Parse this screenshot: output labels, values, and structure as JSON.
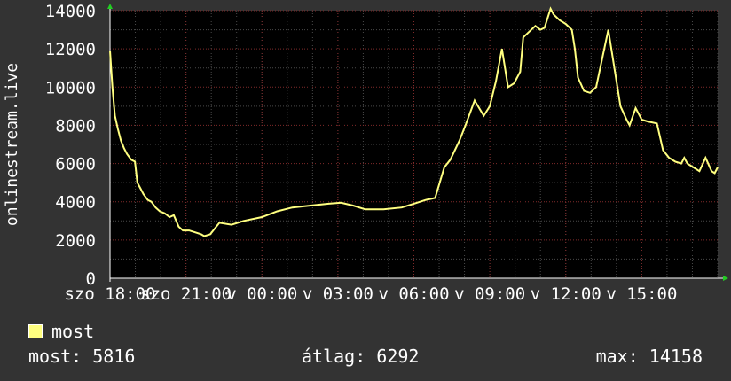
{
  "chart_data": {
    "type": "line",
    "ylabel": "onlinestream.live",
    "ylim": [
      0,
      14000
    ],
    "y_ticks": [
      0,
      2000,
      4000,
      6000,
      8000,
      10000,
      12000,
      14000
    ],
    "x_ticks": [
      {
        "label": "szo 18:00",
        "pos": 0.0
      },
      {
        "label": "szo 21:00",
        "pos": 0.125
      },
      {
        "label": "v 00:00",
        "pos": 0.25
      },
      {
        "label": "v 03:00",
        "pos": 0.375
      },
      {
        "label": "v 06:00",
        "pos": 0.5
      },
      {
        "label": "v 09:00",
        "pos": 0.625
      },
      {
        "label": "v 12:00",
        "pos": 0.75
      },
      {
        "label": "v 15:00",
        "pos": 0.875
      }
    ],
    "x_range": [
      0,
      1
    ],
    "grid": true,
    "series": [
      {
        "name": "most",
        "color": "#ffff80",
        "x": [
          0.0,
          0.004,
          0.008,
          0.013,
          0.018,
          0.023,
          0.028,
          0.035,
          0.041,
          0.045,
          0.05,
          0.055,
          0.062,
          0.068,
          0.075,
          0.082,
          0.09,
          0.098,
          0.105,
          0.113,
          0.12,
          0.13,
          0.14,
          0.15,
          0.155,
          0.165,
          0.18,
          0.2,
          0.22,
          0.25,
          0.275,
          0.3,
          0.33,
          0.36,
          0.38,
          0.4,
          0.42,
          0.45,
          0.48,
          0.5,
          0.52,
          0.535,
          0.55,
          0.56,
          0.575,
          0.585,
          0.6,
          0.615,
          0.625,
          0.635,
          0.645,
          0.655,
          0.665,
          0.675,
          0.68,
          0.69,
          0.7,
          0.708,
          0.715,
          0.725,
          0.73,
          0.74,
          0.75,
          0.76,
          0.765,
          0.77,
          0.78,
          0.79,
          0.8,
          0.82,
          0.84,
          0.85,
          0.855,
          0.865,
          0.875,
          0.885,
          0.9,
          0.91,
          0.92,
          0.93,
          0.94,
          0.945,
          0.95,
          0.96,
          0.97,
          0.98,
          0.99,
          0.995,
          1.0
        ],
        "values": [
          11900,
          10000,
          8500,
          7800,
          7200,
          6800,
          6500,
          6200,
          6100,
          5000,
          4700,
          4400,
          4100,
          4000,
          3700,
          3500,
          3400,
          3200,
          3300,
          2700,
          2500,
          2500,
          2400,
          2300,
          2200,
          2300,
          2900,
          2800,
          3000,
          3200,
          3500,
          3700,
          3800,
          3900,
          3950,
          3800,
          3600,
          3600,
          3700,
          3900,
          4100,
          4200,
          5800,
          6200,
          7200,
          8000,
          9300,
          8500,
          9000,
          10300,
          12000,
          10000,
          10200,
          10800,
          12600,
          12900,
          13200,
          13000,
          13100,
          14100,
          13800,
          13500,
          13300,
          13000,
          12000,
          10500,
          9800,
          9700,
          10000,
          13000,
          9000,
          8300,
          8000,
          8900,
          8300,
          8200,
          8100,
          6700,
          6300,
          6100,
          6000,
          6300,
          6000,
          5800,
          5600,
          6300,
          5600,
          5500,
          5800
        ]
      }
    ]
  },
  "legend": {
    "label": "most",
    "color": "#ffff80"
  },
  "stats": {
    "current": "most: 5816",
    "average": "átlag: 6292",
    "maximum": "max: 14158"
  }
}
